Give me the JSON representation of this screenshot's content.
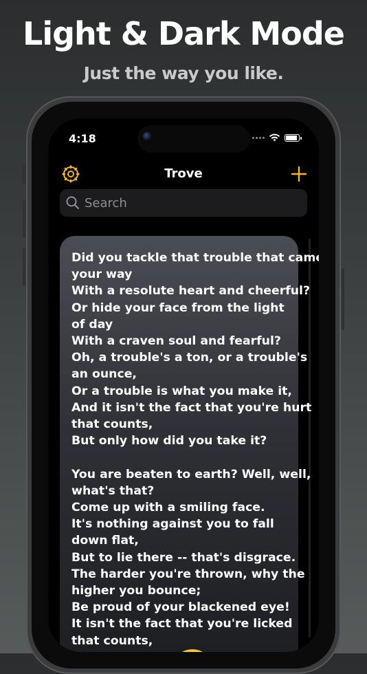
{
  "promo": {
    "headline": "Light & Dark Mode",
    "subheadline": "Just the way you like."
  },
  "status_bar": {
    "time": "4:18",
    "icons": [
      "signal-dots-icon",
      "wifi-icon",
      "battery-icon"
    ]
  },
  "nav": {
    "title": "Trove",
    "left_icon": "gear-icon",
    "right_icon": "plus-icon",
    "accent_color": "#f5b824"
  },
  "search": {
    "placeholder": "Search"
  },
  "card": {
    "lines": [
      "Did you tackle that trouble that came",
      "your way",
      "With a resolute heart and cheerful?",
      "Or hide your face from the light",
      "of day",
      "With a craven soul and fearful?",
      "Oh, a trouble's a ton, or a trouble's",
      "an ounce,",
      "Or a trouble is what you make it,",
      "And it isn't the fact that you're hurt",
      "that counts,",
      "But only how did you take it?",
      "",
      "You are beaten to earth? Well, well,",
      "what's that?",
      "Come up with a smiling face.",
      "It's nothing against you to fall",
      "down flat,",
      "But to lie there -- that's disgrace.",
      "The harder you're thrown, why the",
      "higher you bounce;",
      "Be proud of your blackened eye!",
      "It isn't the fact that you're licked",
      "that counts,"
    ]
  },
  "colors": {
    "background_top": "#2b2d2e",
    "background_bottom": "#575b5a",
    "card_top": "#4a4d53",
    "card_bottom": "#1c1d21",
    "fab": "#f7c623"
  }
}
